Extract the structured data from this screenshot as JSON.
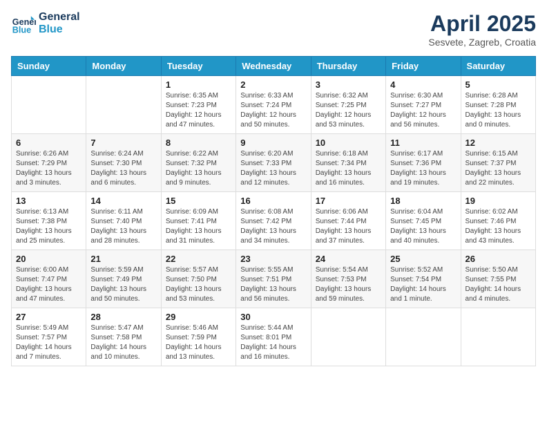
{
  "header": {
    "logo_line1": "General",
    "logo_line2": "Blue",
    "month": "April 2025",
    "location": "Sesvete, Zagreb, Croatia"
  },
  "weekdays": [
    "Sunday",
    "Monday",
    "Tuesday",
    "Wednesday",
    "Thursday",
    "Friday",
    "Saturday"
  ],
  "weeks": [
    [
      {
        "day": "",
        "info": ""
      },
      {
        "day": "",
        "info": ""
      },
      {
        "day": "1",
        "info": "Sunrise: 6:35 AM\nSunset: 7:23 PM\nDaylight: 12 hours and 47 minutes."
      },
      {
        "day": "2",
        "info": "Sunrise: 6:33 AM\nSunset: 7:24 PM\nDaylight: 12 hours and 50 minutes."
      },
      {
        "day": "3",
        "info": "Sunrise: 6:32 AM\nSunset: 7:25 PM\nDaylight: 12 hours and 53 minutes."
      },
      {
        "day": "4",
        "info": "Sunrise: 6:30 AM\nSunset: 7:27 PM\nDaylight: 12 hours and 56 minutes."
      },
      {
        "day": "5",
        "info": "Sunrise: 6:28 AM\nSunset: 7:28 PM\nDaylight: 13 hours and 0 minutes."
      }
    ],
    [
      {
        "day": "6",
        "info": "Sunrise: 6:26 AM\nSunset: 7:29 PM\nDaylight: 13 hours and 3 minutes."
      },
      {
        "day": "7",
        "info": "Sunrise: 6:24 AM\nSunset: 7:30 PM\nDaylight: 13 hours and 6 minutes."
      },
      {
        "day": "8",
        "info": "Sunrise: 6:22 AM\nSunset: 7:32 PM\nDaylight: 13 hours and 9 minutes."
      },
      {
        "day": "9",
        "info": "Sunrise: 6:20 AM\nSunset: 7:33 PM\nDaylight: 13 hours and 12 minutes."
      },
      {
        "day": "10",
        "info": "Sunrise: 6:18 AM\nSunset: 7:34 PM\nDaylight: 13 hours and 16 minutes."
      },
      {
        "day": "11",
        "info": "Sunrise: 6:17 AM\nSunset: 7:36 PM\nDaylight: 13 hours and 19 minutes."
      },
      {
        "day": "12",
        "info": "Sunrise: 6:15 AM\nSunset: 7:37 PM\nDaylight: 13 hours and 22 minutes."
      }
    ],
    [
      {
        "day": "13",
        "info": "Sunrise: 6:13 AM\nSunset: 7:38 PM\nDaylight: 13 hours and 25 minutes."
      },
      {
        "day": "14",
        "info": "Sunrise: 6:11 AM\nSunset: 7:40 PM\nDaylight: 13 hours and 28 minutes."
      },
      {
        "day": "15",
        "info": "Sunrise: 6:09 AM\nSunset: 7:41 PM\nDaylight: 13 hours and 31 minutes."
      },
      {
        "day": "16",
        "info": "Sunrise: 6:08 AM\nSunset: 7:42 PM\nDaylight: 13 hours and 34 minutes."
      },
      {
        "day": "17",
        "info": "Sunrise: 6:06 AM\nSunset: 7:44 PM\nDaylight: 13 hours and 37 minutes."
      },
      {
        "day": "18",
        "info": "Sunrise: 6:04 AM\nSunset: 7:45 PM\nDaylight: 13 hours and 40 minutes."
      },
      {
        "day": "19",
        "info": "Sunrise: 6:02 AM\nSunset: 7:46 PM\nDaylight: 13 hours and 43 minutes."
      }
    ],
    [
      {
        "day": "20",
        "info": "Sunrise: 6:00 AM\nSunset: 7:47 PM\nDaylight: 13 hours and 47 minutes."
      },
      {
        "day": "21",
        "info": "Sunrise: 5:59 AM\nSunset: 7:49 PM\nDaylight: 13 hours and 50 minutes."
      },
      {
        "day": "22",
        "info": "Sunrise: 5:57 AM\nSunset: 7:50 PM\nDaylight: 13 hours and 53 minutes."
      },
      {
        "day": "23",
        "info": "Sunrise: 5:55 AM\nSunset: 7:51 PM\nDaylight: 13 hours and 56 minutes."
      },
      {
        "day": "24",
        "info": "Sunrise: 5:54 AM\nSunset: 7:53 PM\nDaylight: 13 hours and 59 minutes."
      },
      {
        "day": "25",
        "info": "Sunrise: 5:52 AM\nSunset: 7:54 PM\nDaylight: 14 hours and 1 minute."
      },
      {
        "day": "26",
        "info": "Sunrise: 5:50 AM\nSunset: 7:55 PM\nDaylight: 14 hours and 4 minutes."
      }
    ],
    [
      {
        "day": "27",
        "info": "Sunrise: 5:49 AM\nSunset: 7:57 PM\nDaylight: 14 hours and 7 minutes."
      },
      {
        "day": "28",
        "info": "Sunrise: 5:47 AM\nSunset: 7:58 PM\nDaylight: 14 hours and 10 minutes."
      },
      {
        "day": "29",
        "info": "Sunrise: 5:46 AM\nSunset: 7:59 PM\nDaylight: 14 hours and 13 minutes."
      },
      {
        "day": "30",
        "info": "Sunrise: 5:44 AM\nSunset: 8:01 PM\nDaylight: 14 hours and 16 minutes."
      },
      {
        "day": "",
        "info": ""
      },
      {
        "day": "",
        "info": ""
      },
      {
        "day": "",
        "info": ""
      }
    ]
  ]
}
